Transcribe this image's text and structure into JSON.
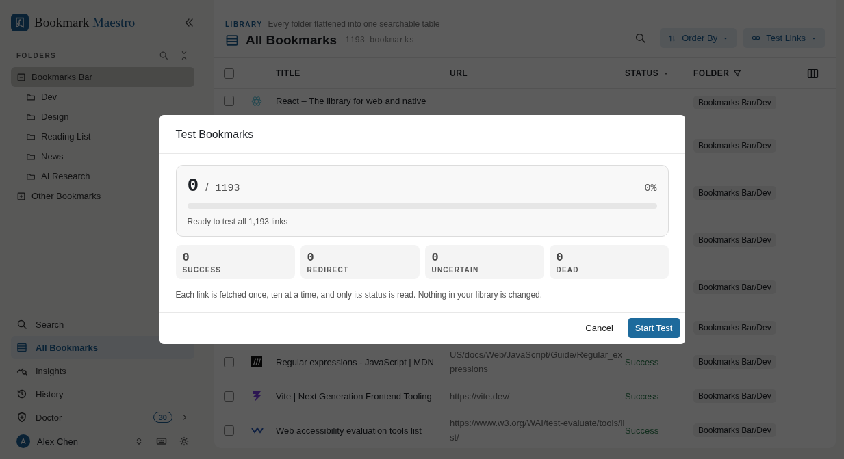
{
  "brand": {
    "name": "Bookmark",
    "accent": "Maestro"
  },
  "folders": {
    "title": "FOLDERS",
    "tree": [
      {
        "label": "Bookmarks Bar",
        "expanded": true,
        "selected": true,
        "children": [
          {
            "label": "Dev",
            "selected": false
          },
          {
            "label": "Design",
            "selected": false
          },
          {
            "label": "Reading List",
            "selected": false
          },
          {
            "label": "News",
            "selected": false
          },
          {
            "label": "AI Research",
            "selected": false
          }
        ]
      },
      {
        "label": "Other Bookmarks",
        "expanded": false,
        "selected": false
      }
    ]
  },
  "nav": [
    {
      "label": "Search",
      "kind": "search",
      "selected": false
    },
    {
      "label": "All Bookmarks",
      "kind": "list",
      "selected": true
    },
    {
      "label": "Insights",
      "kind": "insights",
      "selected": false
    },
    {
      "label": "History",
      "kind": "history",
      "selected": false
    },
    {
      "label": "Doctor",
      "kind": "doctor",
      "selected": false,
      "badge": "30"
    }
  ],
  "user": {
    "initial": "A",
    "name": "Alex Chen"
  },
  "header": {
    "eyebrow": "LIBRARY",
    "subtitle": "Every folder flattened into one searchable table",
    "title": "All Bookmarks",
    "count": "1193 bookmarks",
    "buttons": [
      {
        "label": "Order By",
        "kind": "sort"
      },
      {
        "label": "Test Links",
        "kind": "link"
      }
    ]
  },
  "table": {
    "columns": [
      {
        "label": "TITLE",
        "kind": "plain"
      },
      {
        "label": "URL",
        "kind": "plain"
      },
      {
        "label": "STATUS",
        "kind": "sort"
      },
      {
        "label": "FOLDER",
        "kind": "filter"
      }
    ],
    "all_checked": false,
    "rows": [
      {
        "checked": false,
        "favicon": {
          "kind": "atom"
        },
        "title": "React – The library for web and native",
        "folder": "Bookmarks Bar/Dev"
      },
      {
        "folder": "Bookmarks Bar/Dev"
      },
      {
        "folder": "Bookmarks Bar/Dev"
      },
      {
        "folder": "Bookmarks Bar/Dev"
      },
      {
        "folder": "Bookmarks Bar/Dev"
      },
      {
        "folder": "Bookmarks Bar/Dev"
      },
      {
        "checked": false,
        "favicon": {
          "kind": "letter"
        },
        "title": "Regular expressions - JavaScript | MDN",
        "url": "US/docs/Web/JavaScript/Guide/Regular_expressions",
        "status": "Success",
        "folder": "Bookmarks Bar/Dev"
      },
      {
        "checked": false,
        "favicon": {
          "kind": "bolt"
        },
        "title": "Vite | Next Generation Frontend Tooling",
        "url": "https://vite.dev/",
        "status": "Success",
        "folder": "Bookmarks Bar/Dev"
      },
      {
        "checked": false,
        "favicon": {
          "kind": "wave"
        },
        "title": "Web accessibility evaluation tools list",
        "url": "https://www.w3.org/WAI/test-evaluate/tools/list/",
        "status": "Success",
        "folder": "Bookmarks Bar/Dev"
      }
    ]
  },
  "dialog": {
    "title": "Test Bookmarks",
    "done": "0",
    "separator": "/",
    "total": "1193",
    "percent": "0%",
    "level": 0,
    "message": "Ready to test all 1,193 links",
    "stats": [
      {
        "value": "0",
        "label": "SUCCESS"
      },
      {
        "value": "0",
        "label": "REDIRECT"
      },
      {
        "value": "0",
        "label": "UNCERTAIN"
      },
      {
        "value": "0",
        "label": "DEAD"
      }
    ],
    "note": "Each link is fetched once, ten at a time, and only its status is read. Nothing in your library is changed.",
    "buttons": [
      {
        "label": "Cancel",
        "kind": "secondary"
      },
      {
        "label": "Start Test",
        "kind": "primary"
      }
    ]
  }
}
